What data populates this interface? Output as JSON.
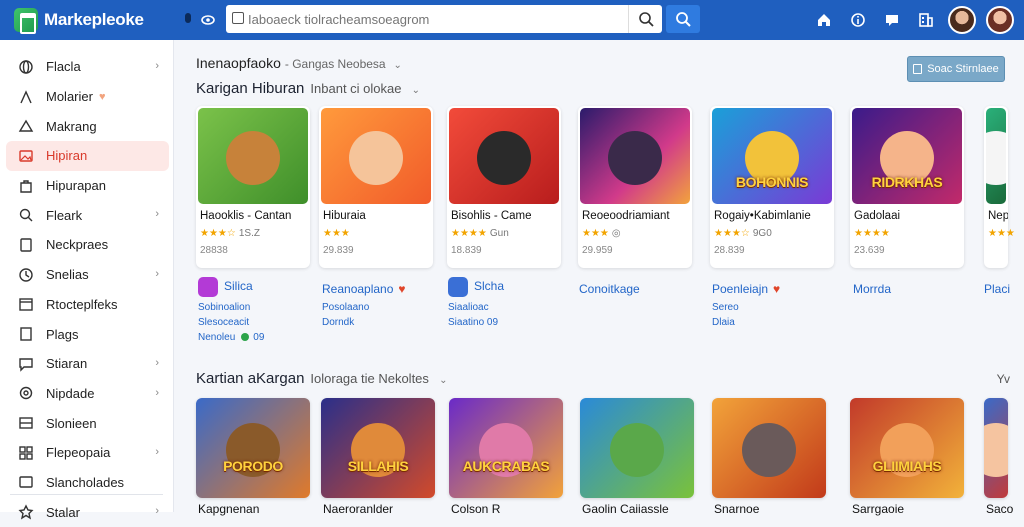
{
  "app": {
    "name": "Markepleoke"
  },
  "search": {
    "placeholder": "Iaboaeck tiolracheamsoeagrom"
  },
  "topbar": {
    "icons": [
      "home-icon",
      "info-icon",
      "bookmark-icon",
      "building-icon"
    ]
  },
  "sidebar": {
    "items": [
      {
        "label": "Flacla",
        "icon": "globe-icon",
        "chevron": true
      },
      {
        "label": "Molarier",
        "icon": "user-icon",
        "heart": true
      },
      {
        "label": "Makrang",
        "icon": "triangle-icon"
      },
      {
        "label": "Hipiran",
        "icon": "image-icon",
        "active": true
      },
      {
        "label": "Hipurapan",
        "icon": "bag-icon"
      },
      {
        "label": "Fleark",
        "icon": "search-icon",
        "chevron": true
      },
      {
        "label": "Neckpraes",
        "icon": "document-icon"
      },
      {
        "label": "Snelias",
        "icon": "clock-icon",
        "chevron": true
      },
      {
        "label": "Rtocteplfeks",
        "icon": "calendar-icon"
      },
      {
        "label": "Plags",
        "icon": "tag-icon"
      },
      {
        "label": "Stiaran",
        "icon": "chat-icon",
        "chevron": true
      },
      {
        "label": "Nipdade",
        "icon": "gear-icon",
        "chevron": true
      },
      {
        "label": "Slonieen",
        "icon": "stack-icon"
      },
      {
        "label": "Flepeopaia",
        "icon": "grid-icon",
        "chevron": true
      },
      {
        "label": "Slancholades",
        "icon": "list-icon"
      },
      {
        "label": "Stalar",
        "icon": "star-icon",
        "chevron": true
      }
    ]
  },
  "breadcrumb": {
    "title": "Inenaopfaoko",
    "sub": "- Gangas Neobesa"
  },
  "top_action": {
    "label": "Soac Stirnlaee"
  },
  "section1": {
    "title": "Karigan Hiburan",
    "sub": "Inbant ci olokae",
    "cards": [
      {
        "title": "Haooklis - Cantan",
        "stars": "★★★☆",
        "rating": "1S.Z",
        "downloads": "28838",
        "art": "bear"
      },
      {
        "title": "Hiburaia",
        "stars": "★★★",
        "rating": "",
        "downloads": "29.839",
        "art": "kid"
      },
      {
        "title": "Bisohlis - Came",
        "stars": "★★★★",
        "rating": "Gun",
        "downloads": "18.839",
        "art": "phone"
      },
      {
        "title": "Reoeoodriamiant",
        "stars": "★★★",
        "rating": "◎",
        "downloads": "29.959",
        "art": "heroes"
      },
      {
        "title": "Rogaiy•Kabimlanie",
        "stars": "★★★☆",
        "rating": "9G0",
        "downloads": "28.839",
        "art": "chaos",
        "art_text": "BOHONNIS"
      },
      {
        "title": "Gadolaai",
        "stars": "★★★★",
        "rating": "",
        "downloads": "23.639",
        "art": "ridr",
        "art_text": "RIDRKHAS"
      },
      {
        "title": "Nep",
        "stars": "★★★",
        "rating": "",
        "downloads": "",
        "art": "edge"
      }
    ],
    "publishers": [
      {
        "name": "Silica",
        "sub1": "Sobinoalion",
        "sub2": "Slesoceacit",
        "sub3": "Nenoleu",
        "sub3_extra": "09",
        "icon_color": "#b33ad6"
      },
      {
        "name": "Reanoaplano",
        "sub1": "Posolaano",
        "sub2": "Dorndk",
        "heart": true
      },
      {
        "name": "Slcha",
        "sub1": "Siaalioac",
        "sub2": "Siaatino 09",
        "icon_color": "#3a6fd6"
      },
      {
        "name": "Conoitkage"
      },
      {
        "name": "Poenleiajn",
        "sub1": "Sereo",
        "sub2": "Dlaia",
        "heart": true
      },
      {
        "name": "Morrda"
      },
      {
        "name": "Placi"
      }
    ]
  },
  "section2": {
    "title": "Kartian aKargan",
    "sub": "Ioloraga tie Nekoltes",
    "right": "Yv",
    "cards": [
      {
        "title": "Kapgnenan",
        "art_text": "PORODO",
        "art": "cowboy"
      },
      {
        "title": "Naeroranlder",
        "art_text": "SILLAHIS",
        "art": "squad"
      },
      {
        "title": "Colson R",
        "art_text": "AUKCRABAS",
        "art": "crab"
      },
      {
        "title": "Gaolin Caiiassle",
        "art": "goblin"
      },
      {
        "title": "Snarnoe",
        "art": "laptop"
      },
      {
        "title": "Sarrgaoie",
        "art_text": "GLIIMIAHS",
        "art": "crowd"
      },
      {
        "title": "Saco",
        "art": "edge2"
      }
    ]
  },
  "colors": {
    "topbar": "#1f5fbf",
    "accent": "#2f7be0",
    "active_bg": "#fde8e6",
    "active_text": "#d93a2b",
    "link": "#2366c8"
  }
}
